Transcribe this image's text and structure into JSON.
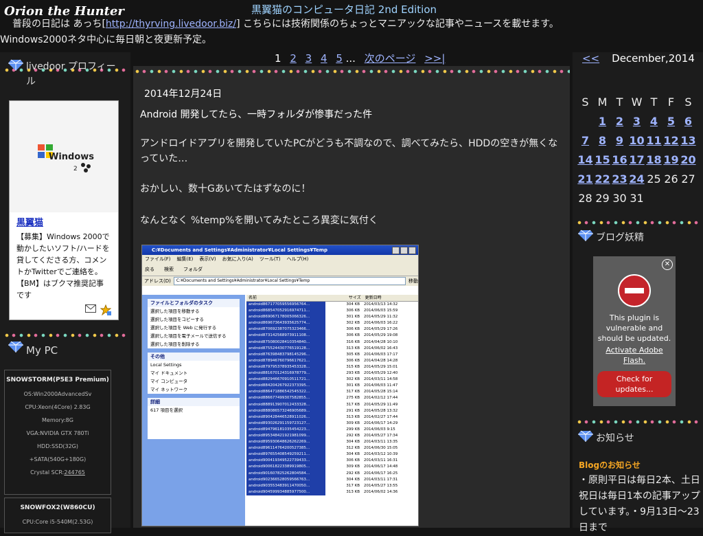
{
  "header": {
    "logo_text": "Orion the Hunter",
    "blog_title": "黒翼猫のコンピュータ日記 2nd Edition",
    "desc_prefix": "普段の日記は あっち[",
    "desc_link": "http://thyrving.livedoor.biz/",
    "desc_suffix": "] こちらには技術関係のちょっとマニアックな記事やニュースを載せます。",
    "desc_line2": "Windows2000ネタ中心に毎日朝と夜更新予定。"
  },
  "pager": {
    "current": "1",
    "pages": [
      "2",
      "3",
      "4",
      "5"
    ],
    "ellipsis": "...",
    "next": "次のページ",
    "last": ">>|"
  },
  "left": {
    "profile_title": "livedoor プロフィール",
    "profile_name": "黒翼猫",
    "profile_text": "【募集】Windows 2000で動かしたいソフト/ハードを貸してくださる方、コメントかTwitterでご連絡を。【BM】はブクマ推奨記事です",
    "logo_word": "Windows",
    "logo_sub": "2",
    "mypc_title": "My PC",
    "pc1": {
      "title": "SNOWSTORM(P5E3 Premium)",
      "lines": [
        "OS:Win2000AdvancedSv",
        "CPU:Xeon(4Core) 2.83G",
        "Memory:8G",
        "VGA:NVIDIA GTX 780Ti",
        "HDD:SSD(32G)",
        "+SATA(540G+180G)"
      ],
      "crystal_label": "Crystal SCR:",
      "crystal_value": "244765"
    },
    "pc2": {
      "title": "SNOWFOX2(W860CU)",
      "line1": "CPU:Core i5-540M(2.53G)"
    }
  },
  "post": {
    "date": "2014年12月24日",
    "title": "Android 開発してたら、一時フォルダが惨事だった件",
    "p1": "アンドロイドアプリを開発していたPCがどうも不調なので、調べてみたら、HDDの空きが無くなっていた…",
    "p2": "おかしい、数十Gあいてたはずなのに！",
    "p3": "なんとなく %temp%を開いてみたところ異変に気付く"
  },
  "explorer": {
    "title": "C:¥Documents and Settings¥Administrator¥Local Settings¥Temp",
    "menu": [
      "ファイル(F)",
      "編集(E)",
      "表示(V)",
      "お気に入り(A)",
      "ツール(T)",
      "ヘルプ(H)"
    ],
    "toolbar": [
      "戻る",
      "検索",
      "フォルダ"
    ],
    "address_label": "アドレス(D)",
    "address": "C:¥Documents and Settings¥Administrator¥Local Settings¥Temp",
    "go": "移動",
    "tasks_head": "ファイルとフォルダのタスク",
    "tasks": [
      "選択した項目を移動する",
      "選択した項目をコピーする",
      "選択した項目を Web に発行する",
      "選択した項目を電子メールで送信する",
      "選択した項目を削除する"
    ],
    "other_head": "その他",
    "other": [
      "Local Settings",
      "マイ ドキュメント",
      "マイ コンピュータ",
      "マイ ネットワーク"
    ],
    "detail_head": "詳細",
    "detail_text": "617 項目を選択",
    "col_name": "名前",
    "col_size": "サイズ",
    "col_date": "更新日時",
    "rows": [
      {
        "n": "android867177059556956764...",
        "s": "304 KB",
        "d": "2014/03/13 14:32"
      },
      {
        "n": "android868547052916974711...",
        "s": "306 KB",
        "d": "2014/06/03 15:59"
      },
      {
        "n": "android869067178005066326...",
        "s": "301 KB",
        "d": "2014/05/29 11:32"
      },
      {
        "n": "android869673643935625774...",
        "s": "302 KB",
        "d": "2014/06/03 16:22"
      },
      {
        "n": "android870692387075323466...",
        "s": "306 KB",
        "d": "2014/05/29 17:26"
      },
      {
        "n": "android873142568973911108...",
        "s": "306 KB",
        "d": "2014/05/29 19:08"
      },
      {
        "n": "android875080028410354840...",
        "s": "316 KB",
        "d": "2014/04/28 10:10"
      },
      {
        "n": "android875524430776519128...",
        "s": "313 KB",
        "d": "2014/06/02 16:43"
      },
      {
        "n": "android876398483798145296...",
        "s": "305 KB",
        "d": "2014/06/03 17:17"
      },
      {
        "n": "android878946760796617621...",
        "s": "306 KB",
        "d": "2014/04/28 14:28"
      },
      {
        "n": "android879795378935453328...",
        "s": "315 KB",
        "d": "2014/05/29 15:01"
      },
      {
        "n": "android881670124316978779...",
        "s": "293 KB",
        "d": "2014/05/29 12:40"
      },
      {
        "n": "android882946670910511721...",
        "s": "302 KB",
        "d": "2014/03/11 14:58"
      },
      {
        "n": "android884204267922373395...",
        "s": "301 KB",
        "d": "2014/06/03 11:47"
      },
      {
        "n": "android886471886542545322...",
        "s": "317 KB",
        "d": "2014/05/28 15:14"
      },
      {
        "n": "android886677499307582855...",
        "s": "275 KB",
        "d": "2014/02/12 17:44"
      },
      {
        "n": "android888913907012433328...",
        "s": "317 KB",
        "d": "2014/05/29 11:49"
      },
      {
        "n": "android888086573246905689...",
        "s": "291 KB",
        "d": "2014/05/28 13:32"
      },
      {
        "n": "android890428446528911026...",
        "s": "313 KB",
        "d": "2014/02/27 17:44"
      },
      {
        "n": "android893026291159723127...",
        "s": "309 KB",
        "d": "2014/06/17 14:29"
      },
      {
        "n": "android894796181035454223...",
        "s": "299 KB",
        "d": "2014/06/03 9:15"
      },
      {
        "n": "android895348421921981099...",
        "s": "292 KB",
        "d": "2014/05/27 17:34"
      },
      {
        "n": "android895930648626262269...",
        "s": "304 KB",
        "d": "2014/03/11 13:35"
      },
      {
        "n": "android896114764200527385...",
        "s": "312 KB",
        "d": "2014/06/30 15:05"
      },
      {
        "n": "android897655408549259211...",
        "s": "304 KB",
        "d": "2014/03/12 10:39"
      },
      {
        "n": "android900419349522739433...",
        "s": "306 KB",
        "d": "2014/03/11 16:31"
      },
      {
        "n": "android900618223389919805...",
        "s": "309 KB",
        "d": "2014/06/17 14:48"
      },
      {
        "n": "android901607825262804584...",
        "s": "292 KB",
        "d": "2014/06/17 16:25"
      },
      {
        "n": "android902366528059566763...",
        "s": "304 KB",
        "d": "2014/03/11 17:31"
      },
      {
        "n": "android903553483911470050...",
        "s": "317 KB",
        "d": "2014/05/27 13:55"
      },
      {
        "n": "android904599934885977500...",
        "s": "313 KB",
        "d": "2014/06/02 14:36"
      }
    ]
  },
  "calendar": {
    "prev": "<<",
    "month": "December,2014",
    "weekdays": [
      "S",
      "M",
      "T",
      "W",
      "T",
      "F",
      "S"
    ],
    "weeks": [
      [
        "",
        "1",
        "2",
        "3",
        "4",
        "5",
        "6"
      ],
      [
        "7",
        "8",
        "9",
        "10",
        "11",
        "12",
        "13"
      ],
      [
        "14",
        "15",
        "16",
        "17",
        "18",
        "19",
        "20"
      ],
      [
        "21",
        "22",
        "23",
        "24",
        "25",
        "26",
        "27"
      ],
      [
        "28",
        "29",
        "30",
        "31",
        "",
        "",
        ""
      ]
    ],
    "linked": [
      "1",
      "2",
      "3",
      "4",
      "5",
      "6",
      "7",
      "8",
      "9",
      "10",
      "11",
      "12",
      "13",
      "14",
      "15",
      "16",
      "17",
      "18",
      "19",
      "20",
      "21",
      "22",
      "23",
      "24"
    ]
  },
  "right": {
    "fairy_title": "ブログ妖精",
    "plugin_msg": "This plugin is vulnerable and should be updated.",
    "plugin_link": "Activate Adobe Flash.",
    "plugin_btn": "Check for updates...",
    "notice_title": "お知らせ",
    "notice_sub": "Blogのお知らせ",
    "notice_text": "・原則平日は毎日2本、土日祝日は毎日1本の記事アップしています。・9月13日〜23日まで"
  },
  "colors": {
    "accent": "#9fb4ff",
    "orange": "#f5a623",
    "red": "#c4242b"
  }
}
